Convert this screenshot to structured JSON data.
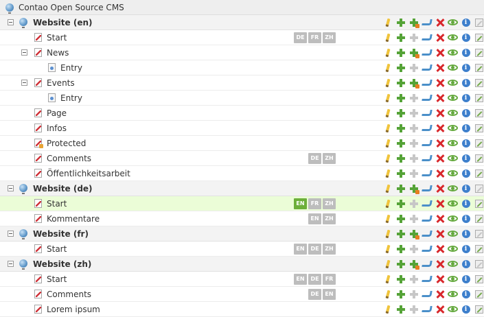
{
  "root_title": "Contao Open Source CMS",
  "rows": [
    {
      "kind": "site",
      "title": "Website (en)",
      "langs": [],
      "child": "plus"
    },
    {
      "kind": "page",
      "title": "Start",
      "langs": [
        "DE",
        "FR",
        "ZH"
      ],
      "child": "gray"
    },
    {
      "kind": "page",
      "title": "News",
      "toggle": true,
      "langs": [],
      "child": "plus"
    },
    {
      "kind": "entry",
      "title": "Entry",
      "langs": [],
      "child": "gray"
    },
    {
      "kind": "page",
      "title": "Events",
      "toggle": true,
      "langs": [],
      "child": "plus"
    },
    {
      "kind": "entry",
      "title": "Entry",
      "langs": [],
      "child": "gray"
    },
    {
      "kind": "page",
      "title": "Page",
      "langs": [],
      "child": "gray"
    },
    {
      "kind": "page",
      "title": "Infos",
      "langs": [],
      "child": "gray"
    },
    {
      "kind": "page",
      "title": "Protected",
      "lock": true,
      "langs": [],
      "child": "gray"
    },
    {
      "kind": "page",
      "title": "Comments",
      "langs": [
        "DE",
        "ZH"
      ],
      "child": "gray"
    },
    {
      "kind": "page",
      "title": "Öffentlichkeitsarbeit",
      "langs": [],
      "child": "gray"
    },
    {
      "kind": "site",
      "title": "Website (de)",
      "langs": [],
      "child": "plus"
    },
    {
      "kind": "page",
      "title": "Start",
      "highlight": true,
      "langs": [
        "EN",
        "FR",
        "ZH"
      ],
      "active_lang": "EN",
      "child": "gray"
    },
    {
      "kind": "page",
      "title": "Kommentare",
      "langs": [
        "EN",
        "ZH"
      ],
      "child": "gray"
    },
    {
      "kind": "site",
      "title": "Website (fr)",
      "langs": [],
      "child": "plus"
    },
    {
      "kind": "page",
      "title": "Start",
      "langs": [
        "EN",
        "DE",
        "ZH"
      ],
      "child": "gray"
    },
    {
      "kind": "site",
      "title": "Website (zh)",
      "langs": [],
      "child": "plus"
    },
    {
      "kind": "page",
      "title": "Start",
      "langs": [
        "EN",
        "DE",
        "FR"
      ],
      "child": "gray"
    },
    {
      "kind": "page",
      "title": "Comments",
      "langs": [
        "DE",
        "EN"
      ],
      "child": "gray"
    },
    {
      "kind": "page",
      "title": "Lorem ipsum",
      "langs": [],
      "child": "gray"
    }
  ],
  "operations": [
    "edit-icon",
    "copy-icon",
    "copy-with-children-icon",
    "cut-move-icon",
    "delete-icon",
    "preview-icon",
    "info-icon",
    "edit-header-icon"
  ]
}
